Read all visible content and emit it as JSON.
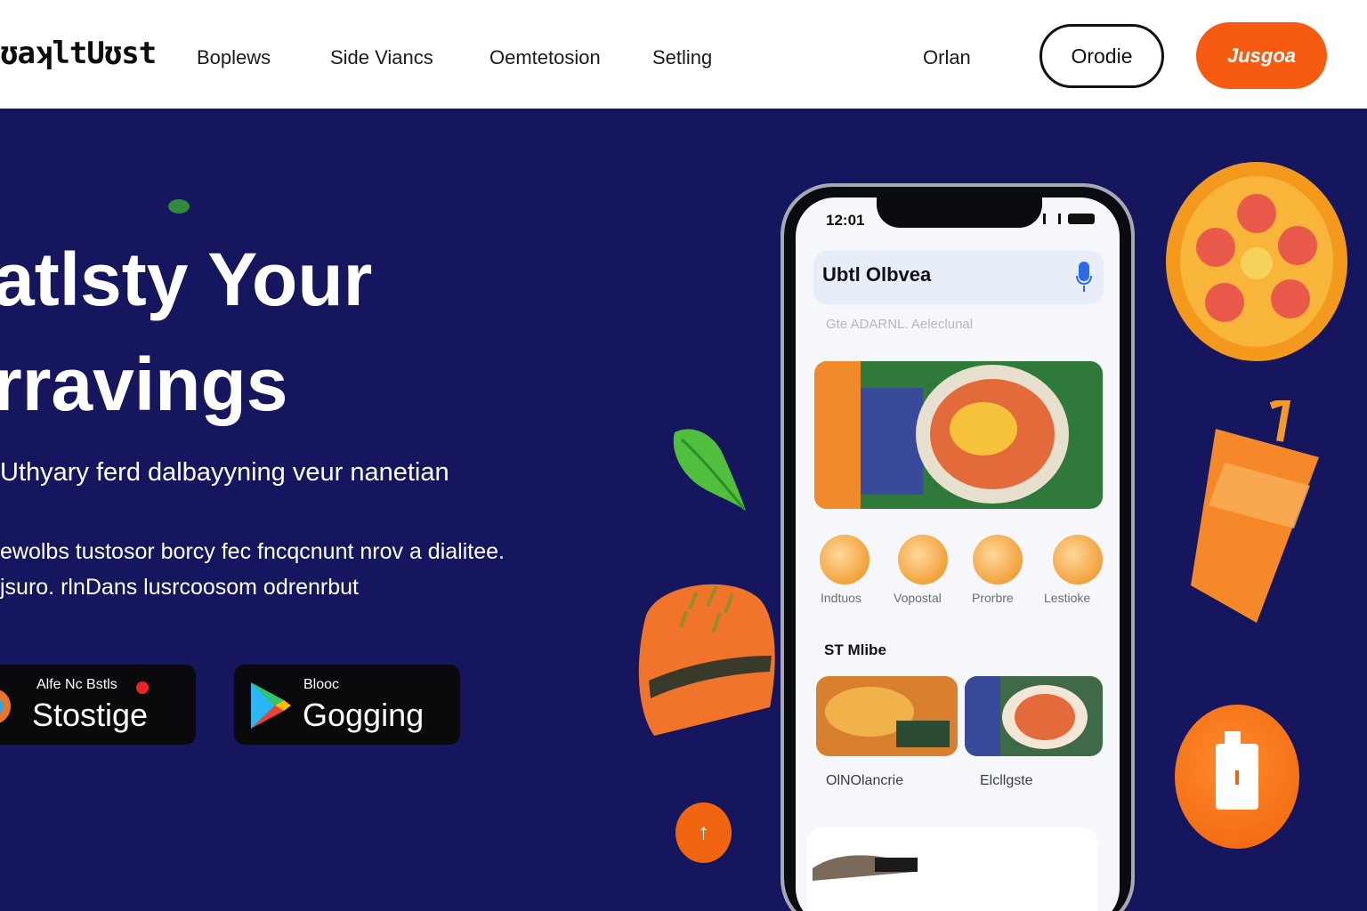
{
  "header": {
    "logo": "ʊaʞltUʊst",
    "nav": [
      "Boplews",
      "Side Viancs",
      "Oemtetosion",
      "Setling"
    ],
    "login_link": "Orlan",
    "outline_button": "Orodie",
    "accent_button": "Jusgoa"
  },
  "hero": {
    "title_line1": "atlsty Your",
    "title_line2": "rravings",
    "subtitle": "Uthyary ferd dalbayyning veur  nanetian",
    "desc_line1": "ewolbs tustosor borcy fec fncqcnunt nrov a dialitee.",
    "desc_line2": "jsuro. rlnDans lusrcoosom odrenrbut"
  },
  "store_buttons": [
    {
      "small": "Alfe Nc Bstls",
      "big": "Stostige"
    },
    {
      "small": "Blooc",
      "big": "Gogging"
    }
  ],
  "phone": {
    "time": "12:01",
    "search_text": "Ubtl Olbvea",
    "hint": "Gte  ADARNL. Aeleclunal",
    "categories": [
      "Indtuos",
      "Vopostal",
      "Prorbre",
      "Lestioke"
    ],
    "section_title": "ST Mlibe",
    "tiles": [
      "OlNOlancrie",
      "Elcllgste"
    ]
  },
  "scroll_top": "↑",
  "colors": {
    "background": "#15165e",
    "accent": "#f75b12",
    "header": "#ffffff"
  },
  "icons": [
    "apple-icon",
    "google-play-icon",
    "microphone-icon",
    "arrow-up-icon",
    "drink-box-icon"
  ]
}
